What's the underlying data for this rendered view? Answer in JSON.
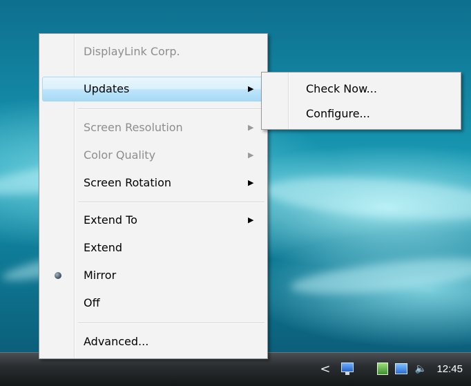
{
  "menu": {
    "header": "DisplayLink Corp.",
    "items": [
      {
        "label": "Updates",
        "arrow": "▶"
      },
      {
        "label": "Screen Resolution",
        "arrow": "▶"
      },
      {
        "label": "Color Quality",
        "arrow": "▶"
      },
      {
        "label": "Screen Rotation",
        "arrow": "▶"
      },
      {
        "label": "Extend To",
        "arrow": "▶"
      },
      {
        "label": "Extend"
      },
      {
        "label": "Mirror",
        "selected": true
      },
      {
        "label": "Off"
      },
      {
        "label": "Advanced..."
      }
    ]
  },
  "submenu": {
    "items": [
      {
        "label": "Check Now..."
      },
      {
        "label": "Configure..."
      }
    ]
  },
  "taskbar": {
    "tray_arrow": "<",
    "clock": "12:45",
    "icons": [
      "network-icon",
      "displaylink-icon",
      "network-status-icon",
      "volume-icon"
    ]
  },
  "colors": {
    "highlight": "#bee6fd",
    "menu_bg": "#f3f3f3",
    "disabled_text": "#8d8d8d"
  }
}
